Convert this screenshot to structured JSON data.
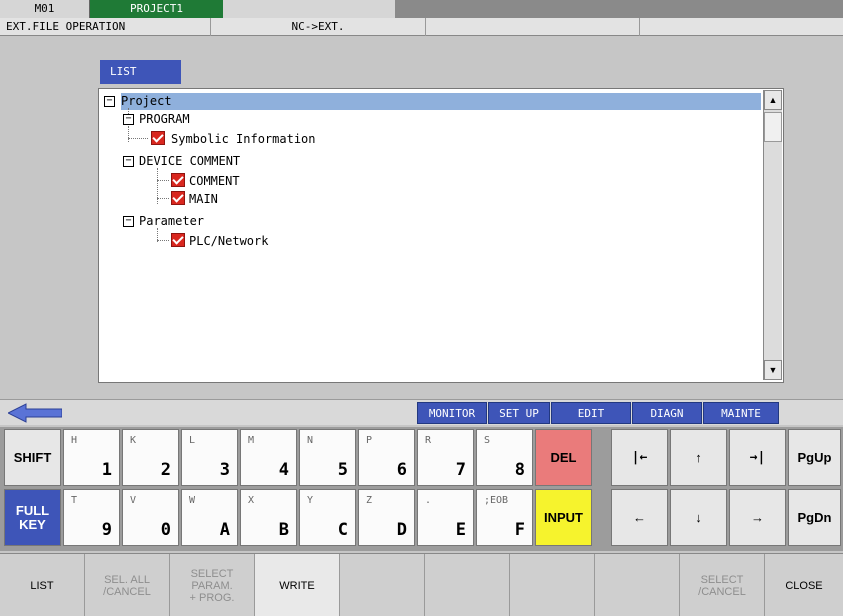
{
  "topbar": {
    "machine": "M01",
    "project": "PROJECT1"
  },
  "opbar": {
    "operation": "EXT.FILE OPERATION",
    "direction": "NC->EXT."
  },
  "list_tab": "LIST",
  "tree": {
    "root": "Project",
    "program": "PROGRAM",
    "symbolic": "Symbolic Information",
    "device_comment": "DEVICE COMMENT",
    "comment": "COMMENT",
    "main": "MAIN",
    "parameter": "Parameter",
    "plc_network": "PLC/Network"
  },
  "func_tabs": [
    "MONITOR",
    "SET UP",
    "EDIT",
    "DIAGN",
    "MAINTE"
  ],
  "keys": {
    "shift": "SHIFT",
    "full": "FULL",
    "key": "KEY",
    "del": "DEL",
    "input": "INPUT",
    "pgup": "PgUp",
    "pgdn": "PgDn",
    "row1": [
      {
        "sub": "H",
        "main": "1"
      },
      {
        "sub": "K",
        "main": "2"
      },
      {
        "sub": "L",
        "main": "3"
      },
      {
        "sub": "M",
        "main": "4"
      },
      {
        "sub": "N",
        "main": "5"
      },
      {
        "sub": "P",
        "main": "6"
      },
      {
        "sub": "R",
        "main": "7"
      },
      {
        "sub": "S",
        "main": "8"
      }
    ],
    "row2": [
      {
        "sub": "T",
        "main": "9"
      },
      {
        "sub": "V",
        "main": "0"
      },
      {
        "sub": "W",
        "main": "A"
      },
      {
        "sub": "X",
        "main": "B"
      },
      {
        "sub": "Y",
        "main": "C"
      },
      {
        "sub": "Z",
        "main": "D"
      },
      {
        "sub": ".",
        "main": "E"
      },
      {
        "sub": ";EOB",
        "main": "F"
      }
    ],
    "arrows": {
      "home": "|←",
      "up": "↑",
      "end": "→|",
      "left": "←",
      "down": "↓",
      "right": "→"
    }
  },
  "softkeys": {
    "list": "LIST",
    "sel_all_1": "SEL. ALL",
    "sel_all_2": "/CANCEL",
    "select_param_1": "SELECT",
    "select_param_2": "PARAM.",
    "select_param_3": "+ PROG.",
    "write": "WRITE",
    "select_cancel_1": "SELECT",
    "select_cancel_2": "/CANCEL",
    "close": "CLOSE"
  },
  "colors": {
    "accent_blue": "#3e55b8",
    "project_green": "#1f7a36",
    "check_red": "#d9271f",
    "del_red": "#ea7b7b",
    "input_yellow": "#f6f32d"
  }
}
